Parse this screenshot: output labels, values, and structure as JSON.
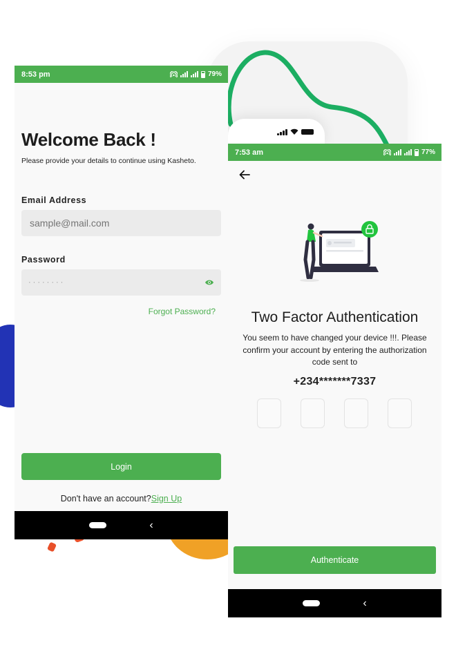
{
  "colors": {
    "accent": "#4caf50",
    "nav_bar": "#000000",
    "illustration_dark": "#2f2e41"
  },
  "login_screen": {
    "status": {
      "time": "8:53 pm",
      "battery": "79%"
    },
    "title": "Welcome Back !",
    "subtitle": "Please provide your details to continue using Kasheto.",
    "email": {
      "label": "Email Address",
      "placeholder": "sample@mail.com"
    },
    "password": {
      "label": "Password",
      "masked_value": "········"
    },
    "forgot_password": "Forgot Password?",
    "login_button": "Login",
    "signup_prompt": "Don't have an account?",
    "signup_link": "Sign Up"
  },
  "tfa_screen": {
    "status": {
      "time": "7:53 am",
      "battery": "77%"
    },
    "title": "Two Factor Authentication",
    "description": "You seem to have changed your device !!!. Please confirm your account by entering the authorization code sent to",
    "phone_number": "+234*******7337",
    "code_length": 4,
    "authenticate_button": "Authenticate"
  },
  "icons": [
    "back-arrow-icon",
    "eye-icon",
    "lock-icon",
    "wifi-icon",
    "battery-icon",
    "signal-icon",
    "hotspot-icon"
  ]
}
